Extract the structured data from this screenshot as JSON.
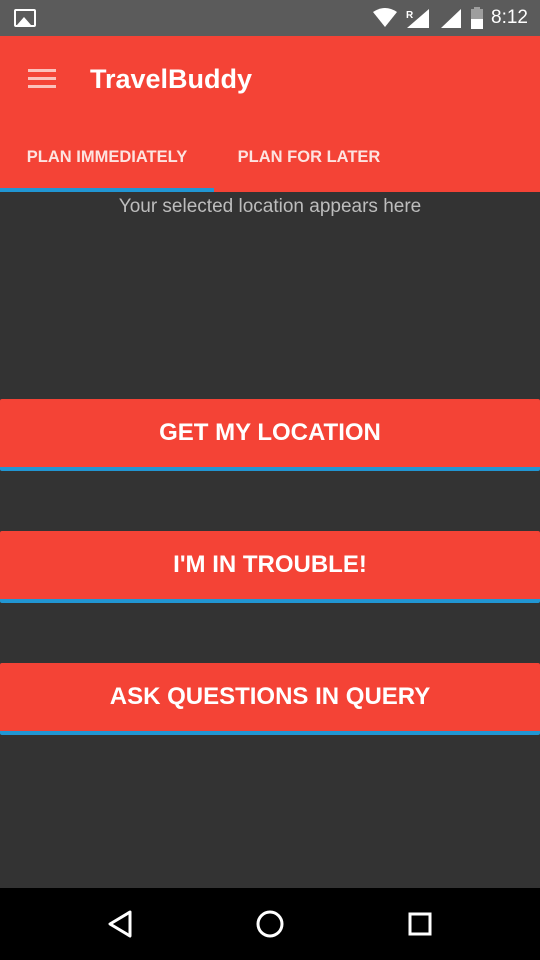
{
  "status_bar": {
    "time": "8:12",
    "icons": [
      "gallery-icon",
      "wifi-icon",
      "signal-roaming-icon",
      "signal-icon",
      "battery-icon"
    ],
    "roaming_label": "R"
  },
  "app_bar": {
    "title": "TravelBuddy",
    "menu_icon": "menu-icon",
    "background_color": "#f44336"
  },
  "tabs": [
    {
      "label": "PLAN IMMEDIATELY",
      "selected": true
    },
    {
      "label": "PLAN FOR LATER",
      "selected": false
    }
  ],
  "main": {
    "location_text": "Your selected location appears here",
    "buttons": [
      {
        "label": "GET MY LOCATION"
      },
      {
        "label": "I'M IN TROUBLE!"
      },
      {
        "label": "ASK QUESTIONS IN QUERY"
      }
    ]
  },
  "nav_bar": {
    "icons": [
      "back-icon",
      "home-icon",
      "recents-icon"
    ]
  },
  "colors": {
    "accent": "#f44336",
    "indicator": "#2196d3",
    "background": "#333333"
  }
}
